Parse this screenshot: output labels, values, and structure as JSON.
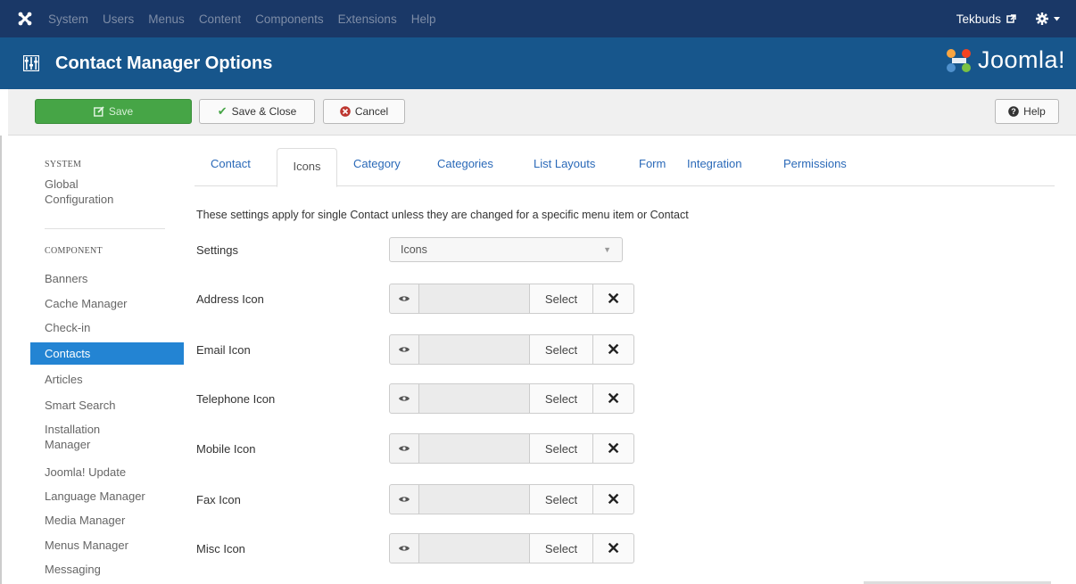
{
  "navbar": {
    "items": [
      "System",
      "Users",
      "Menus",
      "Content",
      "Components",
      "Extensions",
      "Help"
    ],
    "user": "Tekbuds"
  },
  "header": {
    "title": "Contact Manager Options",
    "brand": "Joomla!"
  },
  "toolbar": {
    "save_label": "Save",
    "save_close_label": "Save & Close",
    "cancel_label": "Cancel",
    "help_label": "Help"
  },
  "sidebar": {
    "system_heading": "SYSTEM",
    "global_config": [
      "Global",
      "Configuration"
    ],
    "component_heading": "COMPONENT",
    "items": [
      "Banners",
      "Cache Manager",
      "Check-in",
      "Contacts",
      "Articles",
      "Smart Search",
      "Installation Manager",
      "Joomla! Update",
      "Language Manager",
      "Media Manager",
      "Menus Manager",
      "Messaging"
    ],
    "active": "Contacts"
  },
  "tabs": [
    "Contact",
    "Icons",
    "Category",
    "Categories",
    "List Layouts",
    "Form",
    "Integration",
    "Permissions"
  ],
  "active_tab": "Icons",
  "description": "These settings apply for single Contact unless they are changed for a specific menu item or Contact",
  "settings": {
    "label": "Settings",
    "value": "Icons"
  },
  "icon_fields": [
    {
      "label": "Address Icon",
      "select": "Select",
      "clear": "✕"
    },
    {
      "label": "Email Icon",
      "select": "Select",
      "clear": "✕"
    },
    {
      "label": "Telephone Icon",
      "select": "Select",
      "clear": "✕"
    },
    {
      "label": "Mobile Icon",
      "select": "Select",
      "clear": "✕"
    },
    {
      "label": "Fax Icon",
      "select": "Select",
      "clear": "✕"
    },
    {
      "label": "Misc Icon",
      "select": "Select",
      "clear": "✕"
    }
  ],
  "colors": {
    "navbar": "#1a3867",
    "header": "#17568c",
    "save_green": "#46a546",
    "active_blue": "#2384d3",
    "link_blue": "#2a69b8"
  }
}
